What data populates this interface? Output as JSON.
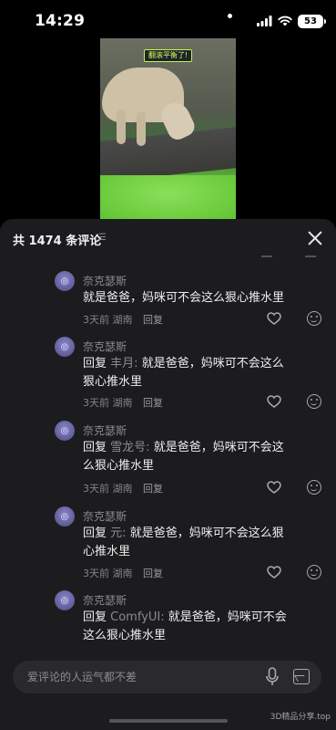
{
  "status_bar": {
    "time": "14:29",
    "battery": "53"
  },
  "video": {
    "caption_tag": "翻滚平衡了!"
  },
  "comments_panel": {
    "count_label": "共 1474 条评论",
    "comments": [
      {
        "username": "奈克瑟斯",
        "reply_prefix": "",
        "reply_to": "",
        "text": "就是爸爸，妈咪可不会这么狠心推水里",
        "time": "3天前",
        "location": "湖南",
        "reply_label": "回复"
      },
      {
        "username": "奈克瑟斯",
        "reply_prefix": "回复",
        "reply_to": "丰月:",
        "text": "就是爸爸，妈咪可不会这么狠心推水里",
        "time": "3天前",
        "location": "湖南",
        "reply_label": "回复"
      },
      {
        "username": "奈克瑟斯",
        "reply_prefix": "回复",
        "reply_to": "雪龙号:",
        "text": "就是爸爸，妈咪可不会这么狠心推水里",
        "time": "3天前",
        "location": "湖南",
        "reply_label": "回复"
      },
      {
        "username": "奈克瑟斯",
        "reply_prefix": "回复",
        "reply_to": "元:",
        "text": "就是爸爸，妈咪可不会这么狠心推水里",
        "time": "3天前",
        "location": "湖南",
        "reply_label": "回复"
      },
      {
        "username": "奈克瑟斯",
        "reply_prefix": "回复",
        "reply_to": "ComfyUI:",
        "text": "就是爸爸，妈咪可不会这么狠心推水里",
        "time": "",
        "location": "",
        "reply_label": ""
      }
    ]
  },
  "input": {
    "placeholder": "爱评论的人运气都不差"
  },
  "watermark": "3D精品分享.top"
}
